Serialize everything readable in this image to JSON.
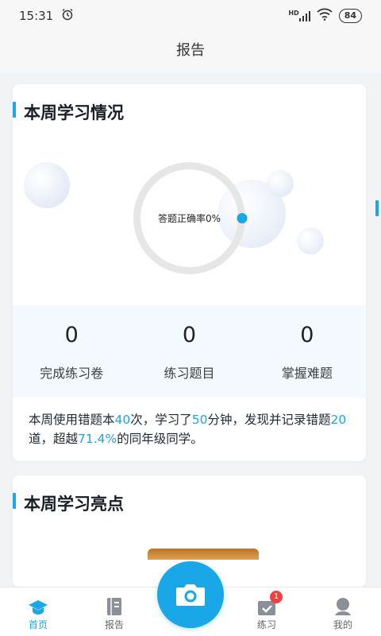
{
  "status_bar": {
    "time": "15:31",
    "battery": "84",
    "network": "HD"
  },
  "header": {
    "title": "报告"
  },
  "weekly_study": {
    "title": "本周学习情况",
    "accuracy_text": "答题正确率0%",
    "accuracy_percent": 0,
    "stats": [
      {
        "value": "0",
        "label": "完成练习卷"
      },
      {
        "value": "0",
        "label": "练习题目"
      },
      {
        "value": "0",
        "label": "掌握难题"
      }
    ],
    "summary": {
      "p1": "本周使用错题本",
      "uses": "40",
      "p2": "次，学习了",
      "minutes": "50",
      "p3": "分钟，发现并记录错题",
      "questions": "20",
      "p4": "道，超越",
      "percent": "71.4%",
      "p5": "的同年级同学。"
    }
  },
  "weekly_highlights": {
    "title": "本周学习亮点"
  },
  "tabbar": {
    "tabs": [
      {
        "label": "首页",
        "icon": "graduation-cap-icon",
        "active": true
      },
      {
        "label": "报告",
        "icon": "report-book-icon",
        "active": false
      },
      {
        "label": "练习",
        "icon": "practice-check-icon",
        "active": false,
        "badge": "1"
      },
      {
        "label": "我的",
        "icon": "user-profile-icon",
        "active": false
      }
    ],
    "camera_icon": "camera-icon"
  },
  "colors": {
    "accent": "#1aa7e8",
    "badge": "#f04040",
    "ring_track": "#e6e6e6"
  }
}
